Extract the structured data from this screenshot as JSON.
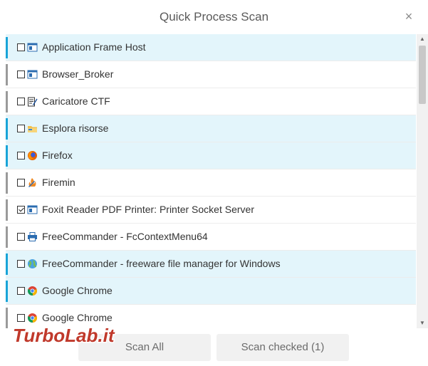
{
  "dialog": {
    "title": "Quick Process Scan",
    "close_glyph": "×"
  },
  "processes": [
    {
      "name": "Application Frame Host",
      "checked": false,
      "highlighted": true,
      "icon": "app-window-icon"
    },
    {
      "name": "Browser_Broker",
      "checked": false,
      "highlighted": false,
      "icon": "app-window-icon"
    },
    {
      "name": "Caricatore CTF",
      "checked": false,
      "highlighted": false,
      "icon": "notepad-pencil-icon"
    },
    {
      "name": "Esplora risorse",
      "checked": false,
      "highlighted": true,
      "icon": "folder-icon"
    },
    {
      "name": "Firefox",
      "checked": false,
      "highlighted": true,
      "icon": "firefox-icon"
    },
    {
      "name": "Firemin",
      "checked": false,
      "highlighted": false,
      "icon": "firemin-icon"
    },
    {
      "name": "Foxit Reader PDF Printer: Printer Socket Server",
      "checked": true,
      "highlighted": false,
      "icon": "app-window-icon"
    },
    {
      "name": "FreeCommander - FcContextMenu64",
      "checked": false,
      "highlighted": false,
      "icon": "printer-icon"
    },
    {
      "name": "FreeCommander - freeware file manager for Windows",
      "checked": false,
      "highlighted": true,
      "icon": "globe-icon"
    },
    {
      "name": "Google Chrome",
      "checked": false,
      "highlighted": true,
      "icon": "chrome-icon"
    },
    {
      "name": "Google Chrome",
      "checked": false,
      "highlighted": false,
      "icon": "chrome-icon"
    }
  ],
  "footer": {
    "scan_all_label": "Scan All",
    "scan_checked_label": "Scan checked (1)"
  },
  "watermark": {
    "text": "TurboLab.it"
  },
  "scrollbar": {
    "up_glyph": "▲",
    "down_glyph": "▼"
  },
  "colors": {
    "highlight_row": "#e3f5fb",
    "accent_bar": "#18a4d8",
    "neutral_bar": "#9a9a9a"
  }
}
